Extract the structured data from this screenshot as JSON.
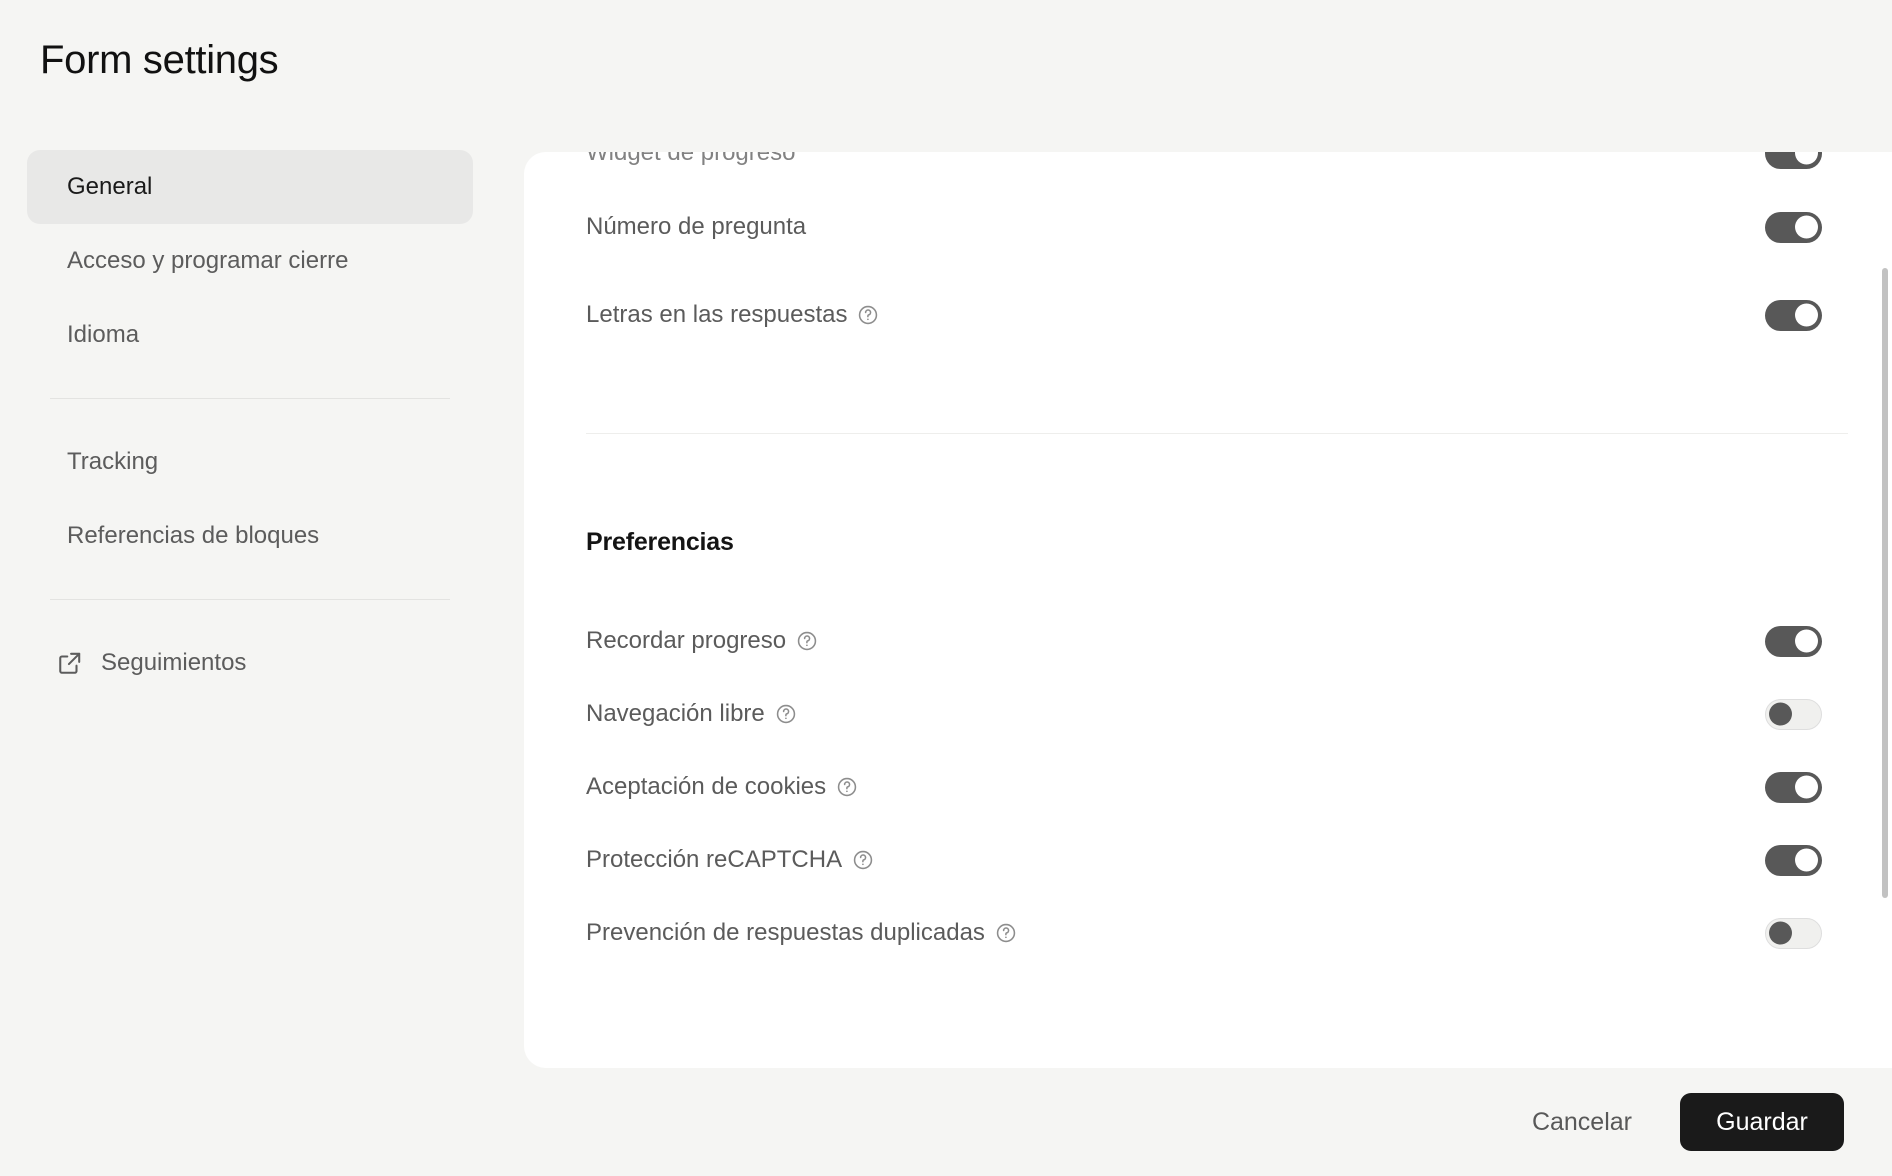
{
  "header": {
    "title": "Form settings"
  },
  "sidebar": {
    "groups": [
      {
        "items": [
          {
            "label": "General",
            "selected": true,
            "icon": null
          },
          {
            "label": "Acceso y programar cierre",
            "selected": false,
            "icon": null
          },
          {
            "label": "Idioma",
            "selected": false,
            "icon": null
          }
        ]
      },
      {
        "items": [
          {
            "label": "Tracking",
            "selected": false,
            "icon": null
          },
          {
            "label": "Referencias de bloques",
            "selected": false,
            "icon": null
          }
        ]
      },
      {
        "items": [
          {
            "label": "Seguimientos",
            "selected": false,
            "icon": "external-link-icon"
          }
        ]
      }
    ]
  },
  "main": {
    "top_settings": [
      {
        "label": "Widget de progreso",
        "help": false,
        "toggle": "on",
        "clipped": true
      },
      {
        "label": "Número de pregunta",
        "help": false,
        "toggle": "on",
        "clipped": false
      },
      {
        "label": "Letras en las respuestas",
        "help": true,
        "toggle": "on",
        "clipped": false
      }
    ],
    "preferences_section": {
      "title": "Preferencias",
      "settings": [
        {
          "label": "Recordar progreso",
          "help": true,
          "toggle": "on"
        },
        {
          "label": "Navegación libre",
          "help": true,
          "toggle": "off"
        },
        {
          "label": "Aceptación de cookies",
          "help": true,
          "toggle": "on"
        },
        {
          "label": "Protección reCAPTCHA",
          "help": true,
          "toggle": "on"
        },
        {
          "label": "Prevención de respuestas duplicadas",
          "help": true,
          "toggle": "off"
        }
      ]
    }
  },
  "footer": {
    "cancel_label": "Cancelar",
    "save_label": "Guardar"
  },
  "colors": {
    "page_background": "#f5f5f3",
    "card_background": "#ffffff",
    "toggle_on": "#585858",
    "toggle_off_track": "#f0f0ee",
    "selected_nav": "#e8e8e7",
    "save_button": "#1a1a1a",
    "label_text": "#5b5b5b",
    "title_text": "#111111"
  }
}
